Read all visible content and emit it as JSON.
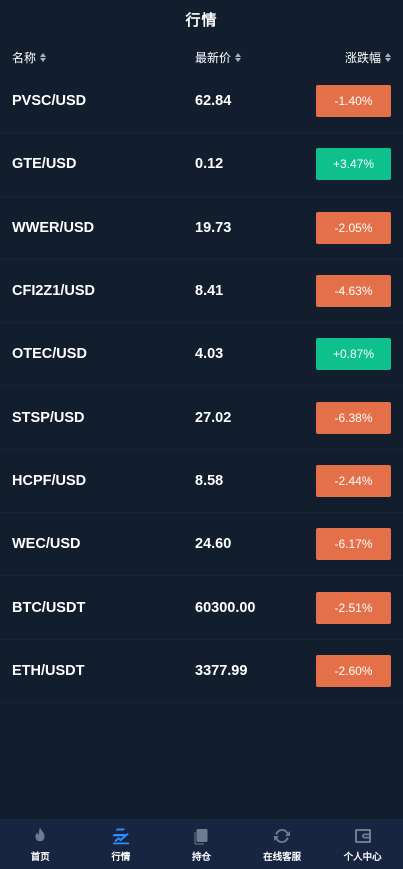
{
  "header": {
    "title": "行情"
  },
  "columns": {
    "name": "名称",
    "price": "最新价",
    "change": "涨跌幅"
  },
  "rows": [
    {
      "pair": "PVSC/USD",
      "price": "62.84",
      "change": "-1.40%",
      "direction": "down"
    },
    {
      "pair": "GTE/USD",
      "price": "0.12",
      "change": "+3.47%",
      "direction": "up"
    },
    {
      "pair": "WWER/USD",
      "price": "19.73",
      "change": "-2.05%",
      "direction": "down"
    },
    {
      "pair": "CFI2Z1/USD",
      "price": "8.41",
      "change": "-4.63%",
      "direction": "down"
    },
    {
      "pair": "OTEC/USD",
      "price": "4.03",
      "change": "+0.87%",
      "direction": "up"
    },
    {
      "pair": "STSP/USD",
      "price": "27.02",
      "change": "-6.38%",
      "direction": "down"
    },
    {
      "pair": "HCPF/USD",
      "price": "8.58",
      "change": "-2.44%",
      "direction": "down"
    },
    {
      "pair": "WEC/USD",
      "price": "24.60",
      "change": "-6.17%",
      "direction": "down"
    },
    {
      "pair": "BTC/USDT",
      "price": "60300.00",
      "change": "-2.51%",
      "direction": "down"
    },
    {
      "pair": "ETH/USDT",
      "price": "3377.99",
      "change": "-2.60%",
      "direction": "down"
    }
  ],
  "tabbar": {
    "items": [
      {
        "label": "首页",
        "icon": "flame-icon",
        "active": false
      },
      {
        "label": "行情",
        "icon": "market-icon",
        "active": true
      },
      {
        "label": "持仓",
        "icon": "document-icon",
        "active": false
      },
      {
        "label": "在线客服",
        "icon": "refresh-icon",
        "active": false
      },
      {
        "label": "个人中心",
        "icon": "wallet-icon",
        "active": false
      }
    ]
  },
  "colors": {
    "background": "#121d2e",
    "tabbar": "#172540",
    "up": "#0ec08b",
    "down": "#e4704a",
    "active_tab": "#2f8cff",
    "inactive_icon": "#6e7b91"
  }
}
